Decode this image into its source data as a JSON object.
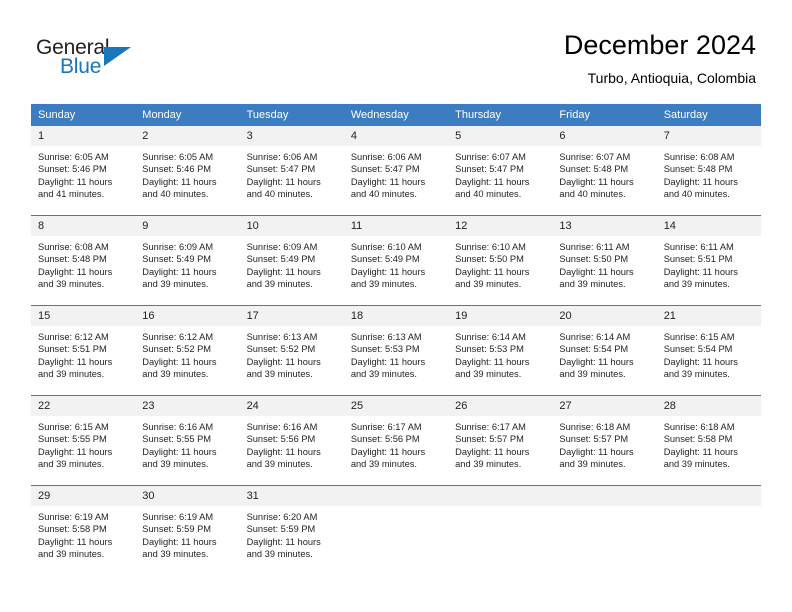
{
  "logo": {
    "word_top": "General",
    "word_bottom": "Blue",
    "accent_color": "#1b76bc"
  },
  "header": {
    "title": "December 2024",
    "subtitle": "Turbo, Antioquia, Colombia"
  },
  "theme": {
    "header_row_bg": "#3b7dc0",
    "daynum_bg": "#f2f2f2",
    "text_color": "#231f20"
  },
  "labels": {
    "sunrise_prefix": "Sunrise:",
    "sunset_prefix": "Sunset:",
    "daylight_prefix": "Daylight:"
  },
  "weekday_headers": [
    "Sunday",
    "Monday",
    "Tuesday",
    "Wednesday",
    "Thursday",
    "Friday",
    "Saturday"
  ],
  "weeks": [
    [
      {
        "day": "1",
        "sunrise": "Sunrise: 6:05 AM",
        "sunset": "Sunset: 5:46 PM",
        "daylight_l1": "Daylight: 11 hours",
        "daylight_l2": "and 41 minutes."
      },
      {
        "day": "2",
        "sunrise": "Sunrise: 6:05 AM",
        "sunset": "Sunset: 5:46 PM",
        "daylight_l1": "Daylight: 11 hours",
        "daylight_l2": "and 40 minutes."
      },
      {
        "day": "3",
        "sunrise": "Sunrise: 6:06 AM",
        "sunset": "Sunset: 5:47 PM",
        "daylight_l1": "Daylight: 11 hours",
        "daylight_l2": "and 40 minutes."
      },
      {
        "day": "4",
        "sunrise": "Sunrise: 6:06 AM",
        "sunset": "Sunset: 5:47 PM",
        "daylight_l1": "Daylight: 11 hours",
        "daylight_l2": "and 40 minutes."
      },
      {
        "day": "5",
        "sunrise": "Sunrise: 6:07 AM",
        "sunset": "Sunset: 5:47 PM",
        "daylight_l1": "Daylight: 11 hours",
        "daylight_l2": "and 40 minutes."
      },
      {
        "day": "6",
        "sunrise": "Sunrise: 6:07 AM",
        "sunset": "Sunset: 5:48 PM",
        "daylight_l1": "Daylight: 11 hours",
        "daylight_l2": "and 40 minutes."
      },
      {
        "day": "7",
        "sunrise": "Sunrise: 6:08 AM",
        "sunset": "Sunset: 5:48 PM",
        "daylight_l1": "Daylight: 11 hours",
        "daylight_l2": "and 40 minutes."
      }
    ],
    [
      {
        "day": "8",
        "sunrise": "Sunrise: 6:08 AM",
        "sunset": "Sunset: 5:48 PM",
        "daylight_l1": "Daylight: 11 hours",
        "daylight_l2": "and 39 minutes."
      },
      {
        "day": "9",
        "sunrise": "Sunrise: 6:09 AM",
        "sunset": "Sunset: 5:49 PM",
        "daylight_l1": "Daylight: 11 hours",
        "daylight_l2": "and 39 minutes."
      },
      {
        "day": "10",
        "sunrise": "Sunrise: 6:09 AM",
        "sunset": "Sunset: 5:49 PM",
        "daylight_l1": "Daylight: 11 hours",
        "daylight_l2": "and 39 minutes."
      },
      {
        "day": "11",
        "sunrise": "Sunrise: 6:10 AM",
        "sunset": "Sunset: 5:49 PM",
        "daylight_l1": "Daylight: 11 hours",
        "daylight_l2": "and 39 minutes."
      },
      {
        "day": "12",
        "sunrise": "Sunrise: 6:10 AM",
        "sunset": "Sunset: 5:50 PM",
        "daylight_l1": "Daylight: 11 hours",
        "daylight_l2": "and 39 minutes."
      },
      {
        "day": "13",
        "sunrise": "Sunrise: 6:11 AM",
        "sunset": "Sunset: 5:50 PM",
        "daylight_l1": "Daylight: 11 hours",
        "daylight_l2": "and 39 minutes."
      },
      {
        "day": "14",
        "sunrise": "Sunrise: 6:11 AM",
        "sunset": "Sunset: 5:51 PM",
        "daylight_l1": "Daylight: 11 hours",
        "daylight_l2": "and 39 minutes."
      }
    ],
    [
      {
        "day": "15",
        "sunrise": "Sunrise: 6:12 AM",
        "sunset": "Sunset: 5:51 PM",
        "daylight_l1": "Daylight: 11 hours",
        "daylight_l2": "and 39 minutes."
      },
      {
        "day": "16",
        "sunrise": "Sunrise: 6:12 AM",
        "sunset": "Sunset: 5:52 PM",
        "daylight_l1": "Daylight: 11 hours",
        "daylight_l2": "and 39 minutes."
      },
      {
        "day": "17",
        "sunrise": "Sunrise: 6:13 AM",
        "sunset": "Sunset: 5:52 PM",
        "daylight_l1": "Daylight: 11 hours",
        "daylight_l2": "and 39 minutes."
      },
      {
        "day": "18",
        "sunrise": "Sunrise: 6:13 AM",
        "sunset": "Sunset: 5:53 PM",
        "daylight_l1": "Daylight: 11 hours",
        "daylight_l2": "and 39 minutes."
      },
      {
        "day": "19",
        "sunrise": "Sunrise: 6:14 AM",
        "sunset": "Sunset: 5:53 PM",
        "daylight_l1": "Daylight: 11 hours",
        "daylight_l2": "and 39 minutes."
      },
      {
        "day": "20",
        "sunrise": "Sunrise: 6:14 AM",
        "sunset": "Sunset: 5:54 PM",
        "daylight_l1": "Daylight: 11 hours",
        "daylight_l2": "and 39 minutes."
      },
      {
        "day": "21",
        "sunrise": "Sunrise: 6:15 AM",
        "sunset": "Sunset: 5:54 PM",
        "daylight_l1": "Daylight: 11 hours",
        "daylight_l2": "and 39 minutes."
      }
    ],
    [
      {
        "day": "22",
        "sunrise": "Sunrise: 6:15 AM",
        "sunset": "Sunset: 5:55 PM",
        "daylight_l1": "Daylight: 11 hours",
        "daylight_l2": "and 39 minutes."
      },
      {
        "day": "23",
        "sunrise": "Sunrise: 6:16 AM",
        "sunset": "Sunset: 5:55 PM",
        "daylight_l1": "Daylight: 11 hours",
        "daylight_l2": "and 39 minutes."
      },
      {
        "day": "24",
        "sunrise": "Sunrise: 6:16 AM",
        "sunset": "Sunset: 5:56 PM",
        "daylight_l1": "Daylight: 11 hours",
        "daylight_l2": "and 39 minutes."
      },
      {
        "day": "25",
        "sunrise": "Sunrise: 6:17 AM",
        "sunset": "Sunset: 5:56 PM",
        "daylight_l1": "Daylight: 11 hours",
        "daylight_l2": "and 39 minutes."
      },
      {
        "day": "26",
        "sunrise": "Sunrise: 6:17 AM",
        "sunset": "Sunset: 5:57 PM",
        "daylight_l1": "Daylight: 11 hours",
        "daylight_l2": "and 39 minutes."
      },
      {
        "day": "27",
        "sunrise": "Sunrise: 6:18 AM",
        "sunset": "Sunset: 5:57 PM",
        "daylight_l1": "Daylight: 11 hours",
        "daylight_l2": "and 39 minutes."
      },
      {
        "day": "28",
        "sunrise": "Sunrise: 6:18 AM",
        "sunset": "Sunset: 5:58 PM",
        "daylight_l1": "Daylight: 11 hours",
        "daylight_l2": "and 39 minutes."
      }
    ],
    [
      {
        "day": "29",
        "sunrise": "Sunrise: 6:19 AM",
        "sunset": "Sunset: 5:58 PM",
        "daylight_l1": "Daylight: 11 hours",
        "daylight_l2": "and 39 minutes."
      },
      {
        "day": "30",
        "sunrise": "Sunrise: 6:19 AM",
        "sunset": "Sunset: 5:59 PM",
        "daylight_l1": "Daylight: 11 hours",
        "daylight_l2": "and 39 minutes."
      },
      {
        "day": "31",
        "sunrise": "Sunrise: 6:20 AM",
        "sunset": "Sunset: 5:59 PM",
        "daylight_l1": "Daylight: 11 hours",
        "daylight_l2": "and 39 minutes."
      },
      {
        "day": "",
        "sunrise": "",
        "sunset": "",
        "daylight_l1": "",
        "daylight_l2": ""
      },
      {
        "day": "",
        "sunrise": "",
        "sunset": "",
        "daylight_l1": "",
        "daylight_l2": ""
      },
      {
        "day": "",
        "sunrise": "",
        "sunset": "",
        "daylight_l1": "",
        "daylight_l2": ""
      },
      {
        "day": "",
        "sunrise": "",
        "sunset": "",
        "daylight_l1": "",
        "daylight_l2": ""
      }
    ]
  ]
}
